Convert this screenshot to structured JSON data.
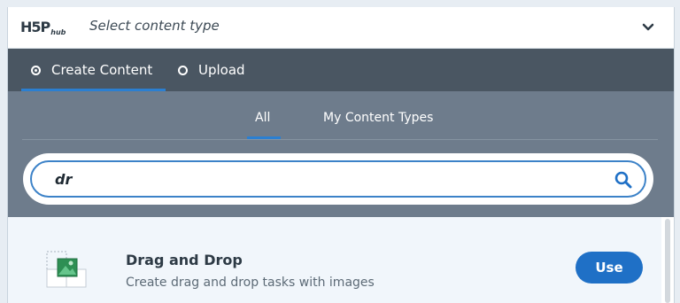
{
  "header": {
    "logo_main": "H5P",
    "logo_hub": "hub",
    "title": "Select content type"
  },
  "mode_tabs": [
    {
      "label": "Create Content",
      "selected": true
    },
    {
      "label": "Upload",
      "selected": false
    }
  ],
  "filter_tabs": [
    {
      "label": "All",
      "active": true
    },
    {
      "label": "My Content Types",
      "active": false
    }
  ],
  "search": {
    "value": "dr"
  },
  "results": [
    {
      "title": "Drag and Drop",
      "description": "Create drag and drop tasks with images",
      "button_label": "Use",
      "icon": "drag-and-drop-icon"
    }
  ],
  "colors": {
    "accent": "#1f70c6",
    "header_bar": "#4a5662",
    "panel": "#6e7c8c"
  }
}
